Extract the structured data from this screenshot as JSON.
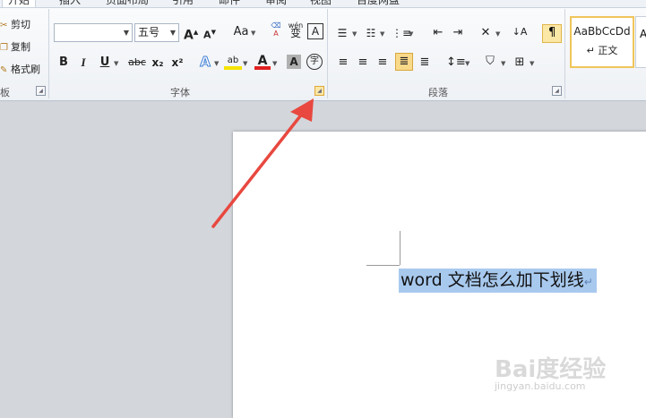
{
  "tabs": [
    "开始",
    "插入",
    "页面布局",
    "引用",
    "邮件",
    "审阅",
    "视图",
    "百度网盘"
  ],
  "clipboard": {
    "cut": "剪切",
    "copy": "复制",
    "format_painter": "格式刷",
    "group_label": "板"
  },
  "font": {
    "font_name": "",
    "font_size": "五号",
    "grow_font": "A",
    "shrink_font": "A",
    "change_case": "Aa",
    "phonetic_guide": "wén",
    "phonetic_char": "变",
    "char_border": "A",
    "bold": "B",
    "italic": "I",
    "underline": "U",
    "strikethrough": "abc",
    "subscript": "x₂",
    "superscript": "x²",
    "text_effects": "A",
    "highlight": "ab",
    "font_color": "A",
    "char_shading": "A",
    "enclose_char": "字",
    "group_label": "字体"
  },
  "paragraph": {
    "group_label": "段落"
  },
  "styles": {
    "normal_preview": "AaBbCcDd",
    "normal_label": "↵ 正文",
    "next_preview": "A"
  },
  "document": {
    "selected_text": "word 文档怎么加下划线",
    "paragraph_mark": "↵"
  },
  "watermark": {
    "logo": "Bai度经验",
    "url": "jingyan.baidu.com"
  },
  "colors": {
    "arrow": "#e8483f",
    "selection": "#a8c9ee",
    "highlight_yellow": "#f6e400",
    "font_red": "#e02020"
  }
}
